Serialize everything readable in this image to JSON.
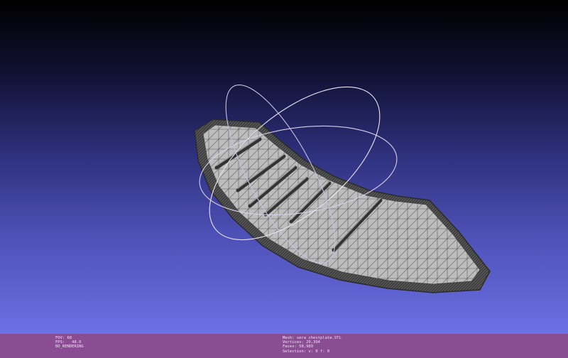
{
  "app": {
    "view": "3D mesh viewport",
    "colors": {
      "background_top": "#000000",
      "background_bottom": "#6b70e4",
      "mesh_fill": "#b9b9b9",
      "mesh_edge": "#4a4a4a",
      "trackball": "#e6e0f0",
      "status_bar": "#8a4d94"
    }
  },
  "status_left": {
    "fov": "FOV: 60",
    "fps": "FPS:   48.0",
    "render_mode": "BO_RENDERING"
  },
  "status_right": {
    "mesh": "Mesh: sera chestplate.STL",
    "vertices": "Vertices: 29,394",
    "faces": "Faces: 58,989",
    "selection": "Selection: v: 0 f: 0"
  },
  "icons": {
    "trackball": "trackball-gizmo-icon"
  }
}
